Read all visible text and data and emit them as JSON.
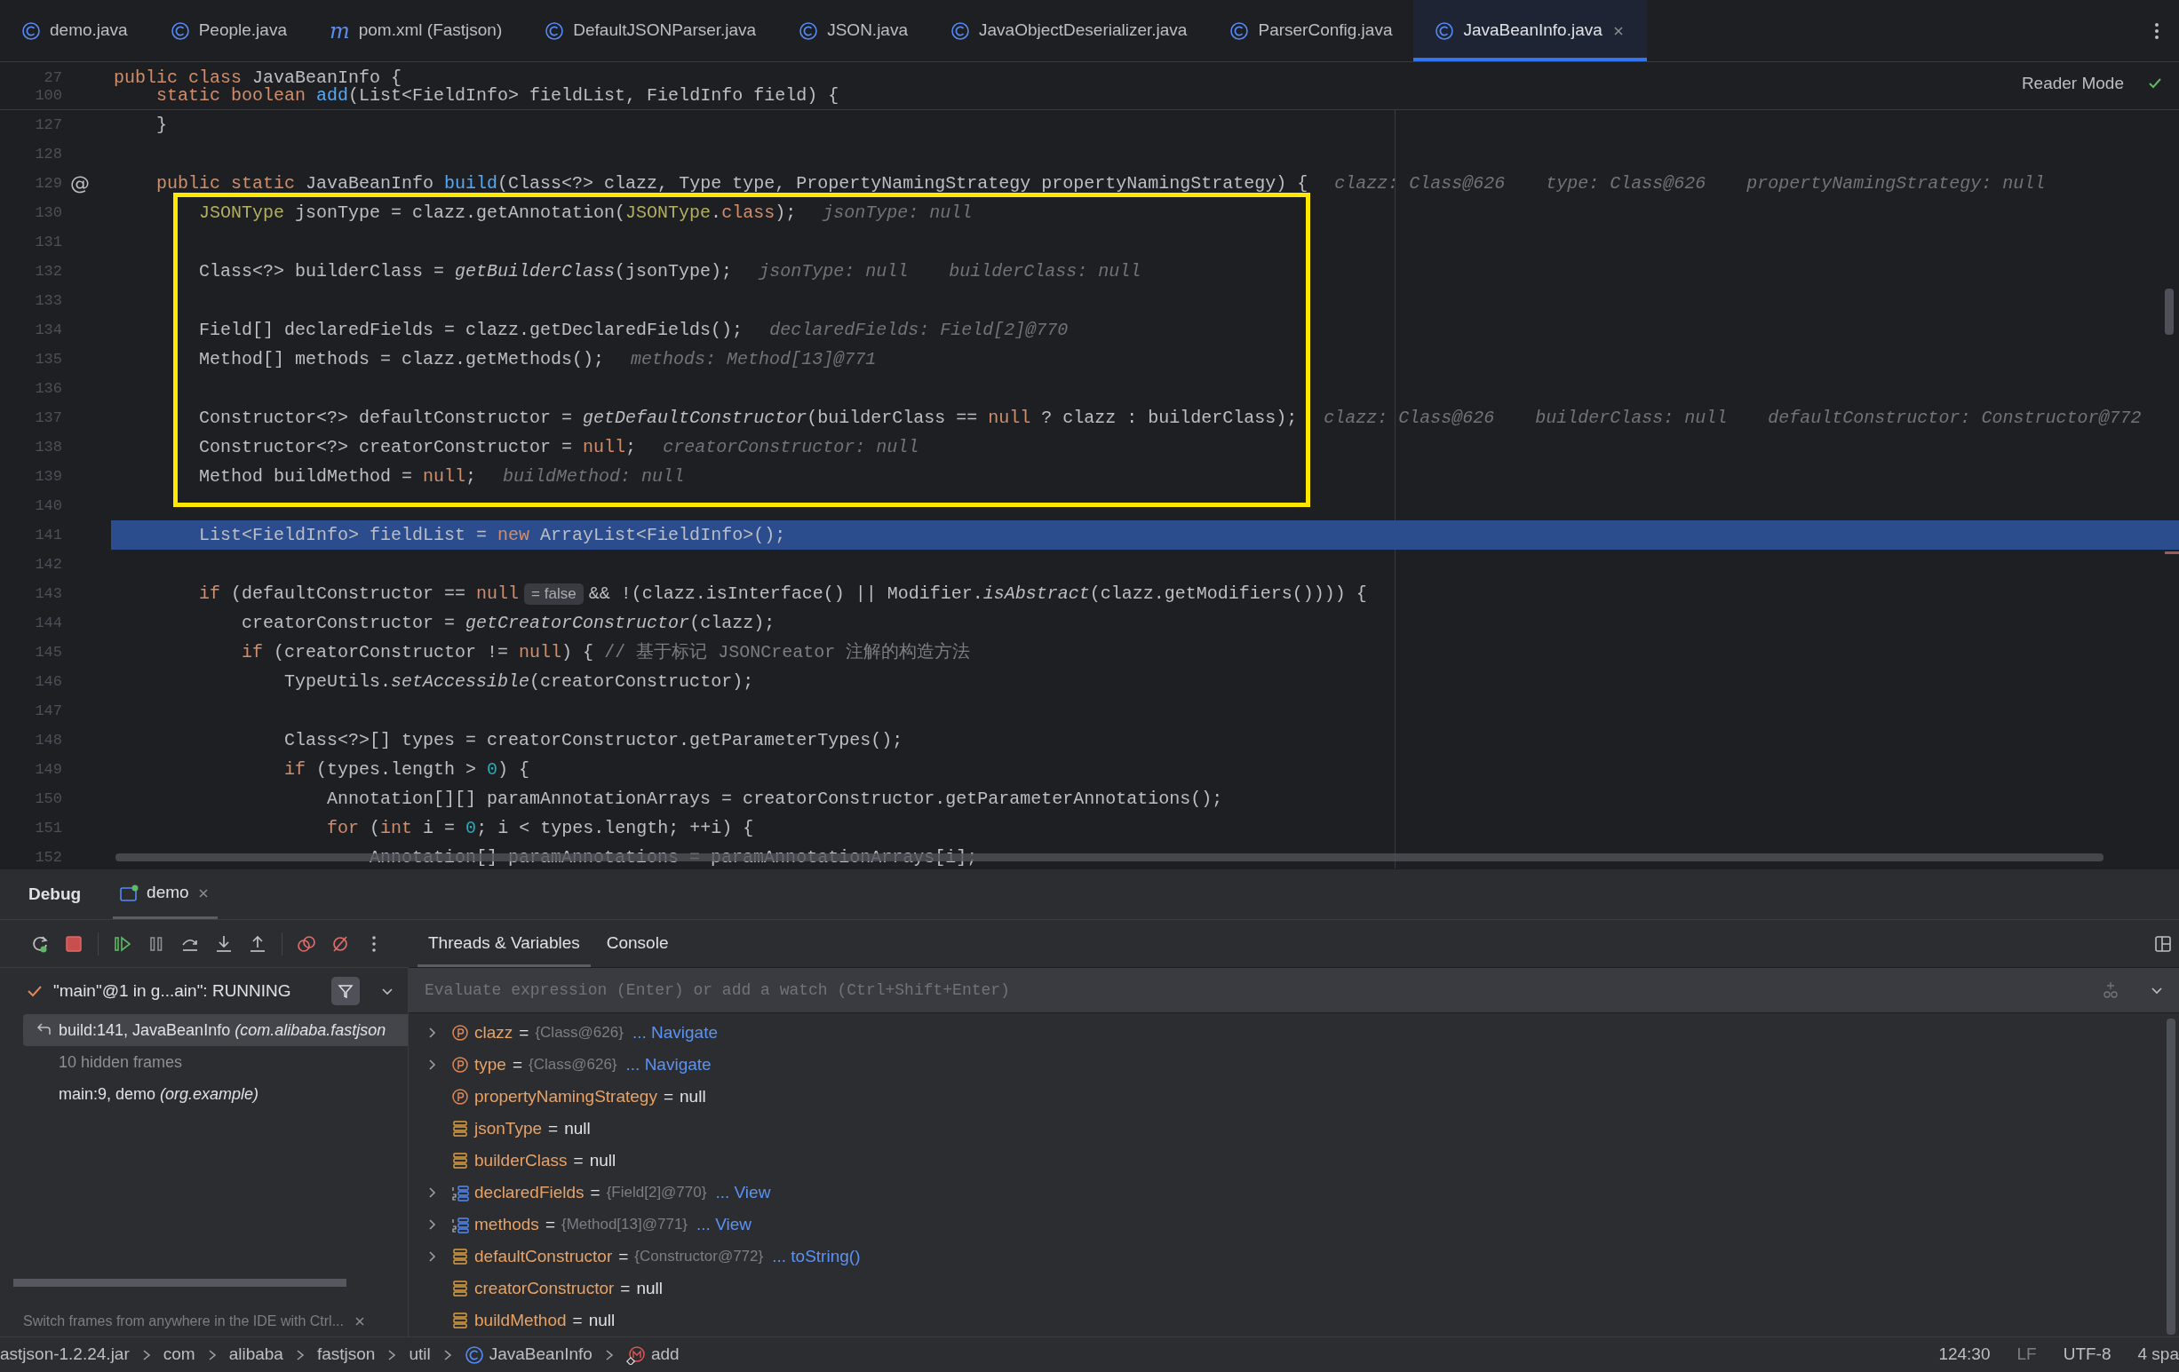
{
  "tabs": [
    {
      "label": "demo.java",
      "kind": "class",
      "selected": false
    },
    {
      "label": "People.java",
      "kind": "class",
      "selected": false
    },
    {
      "label": "pom.xml (Fastjson)",
      "kind": "maven",
      "icon_glyph": "m",
      "selected": false
    },
    {
      "label": "DefaultJSONParser.java",
      "kind": "class",
      "selected": false
    },
    {
      "label": "JSON.java",
      "kind": "class",
      "selected": false
    },
    {
      "label": "JavaObjectDeserializer.java",
      "kind": "class",
      "selected": false
    },
    {
      "label": "ParserConfig.java",
      "kind": "class",
      "selected": false
    },
    {
      "label": "JavaBeanInfo.java",
      "kind": "class",
      "selected": true
    }
  ],
  "editor": {
    "reader_mode": "Reader Mode",
    "sticky_lines": [
      {
        "number": "27",
        "tokens": [
          {
            "text": "public class",
            "kind": "kw"
          },
          {
            "text": " JavaBeanInfo {",
            "kind": "plain"
          }
        ]
      },
      {
        "number": "100",
        "tokens": [
          {
            "text": "    static boolean ",
            "kind": "kw"
          },
          {
            "text": "add",
            "kind": "decl"
          },
          {
            "text": "(List<FieldInfo> fieldList, FieldInfo field) {",
            "kind": "plain"
          }
        ]
      }
    ],
    "lines": [
      {
        "number": "127",
        "tokens": [
          {
            "text": "    }",
            "kind": "plain"
          }
        ],
        "boxed": false,
        "current": false
      },
      {
        "number": "128",
        "boxed": false,
        "current": false
      },
      {
        "number": "129",
        "gutter_mark": "@",
        "tokens": [
          {
            "text": "    public static",
            "kind": "kw"
          },
          {
            "text": " JavaBeanInfo ",
            "kind": "plain"
          },
          {
            "text": "build",
            "kind": "decl"
          },
          {
            "text": "(Class<?> clazz, Type type, PropertyNamingStrategy propertyNamingStrategy) {",
            "kind": "plain"
          }
        ],
        "hints": [
          "clazz: Class@626",
          "type: Class@626",
          "propertyNamingStrategy: null"
        ],
        "boxed": false,
        "current": false
      },
      {
        "number": "130",
        "tokens": [
          {
            "text": "        JSONType",
            "kind": "ann"
          },
          {
            "text": " jsonType = clazz.getAnnotation(",
            "kind": "plain"
          },
          {
            "text": "JSONType",
            "kind": "ann"
          },
          {
            "text": ".",
            "kind": "plain"
          },
          {
            "text": "class",
            "kind": "kw"
          },
          {
            "text": ");",
            "kind": "plain"
          }
        ],
        "hints": [
          "jsonType: null"
        ],
        "boxed": true,
        "current": false
      },
      {
        "number": "131",
        "boxed": true,
        "current": false
      },
      {
        "number": "132",
        "tokens": [
          {
            "text": "        Class<?> builderClass = ",
            "kind": "plain"
          },
          {
            "text": "getBuilderClass",
            "kind": "ital"
          },
          {
            "text": "(jsonType);",
            "kind": "plain"
          }
        ],
        "hints": [
          "jsonType: null",
          "builderClass: null"
        ],
        "boxed": true,
        "current": false
      },
      {
        "number": "133",
        "boxed": true,
        "current": false
      },
      {
        "number": "134",
        "tokens": [
          {
            "text": "        Field[] declaredFields = clazz.getDeclaredFields();",
            "kind": "plain"
          }
        ],
        "hints": [
          "declaredFields: Field[2]@770"
        ],
        "boxed": true,
        "current": false
      },
      {
        "number": "135",
        "tokens": [
          {
            "text": "        Method[] methods = clazz.getMethods();",
            "kind": "plain"
          }
        ],
        "hints": [
          "methods: Method[13]@771"
        ],
        "boxed": true,
        "current": false
      },
      {
        "number": "136",
        "boxed": true,
        "current": false
      },
      {
        "number": "137",
        "tokens": [
          {
            "text": "        Constructor<?> defaultConstructor = ",
            "kind": "plain"
          },
          {
            "text": "getDefaultConstructor",
            "kind": "ital"
          },
          {
            "text": "(builderClass == ",
            "kind": "plain"
          },
          {
            "text": "null",
            "kind": "kw"
          },
          {
            "text": " ? clazz : builderClass);",
            "kind": "plain"
          }
        ],
        "hints": [
          "clazz: Class@626",
          "builderClass: null",
          "defaultConstructor: Constructor@772"
        ],
        "boxed": true,
        "current": false
      },
      {
        "number": "138",
        "tokens": [
          {
            "text": "        Constructor<?> creatorConstructor = ",
            "kind": "plain"
          },
          {
            "text": "null",
            "kind": "kw"
          },
          {
            "text": ";",
            "kind": "plain"
          }
        ],
        "hints": [
          "creatorConstructor: null"
        ],
        "boxed": true,
        "current": false
      },
      {
        "number": "139",
        "tokens": [
          {
            "text": "        Method buildMethod = ",
            "kind": "plain"
          },
          {
            "text": "null",
            "kind": "kw"
          },
          {
            "text": ";",
            "kind": "plain"
          }
        ],
        "hints": [
          "buildMethod: null"
        ],
        "boxed": true,
        "current": false
      },
      {
        "number": "140",
        "boxed": false,
        "current": false
      },
      {
        "number": "141",
        "tokens": [
          {
            "text": "        List<FieldInfo> fieldList = ",
            "kind": "plain"
          },
          {
            "text": "new",
            "kind": "kw"
          },
          {
            "text": " ArrayList<FieldInfo>();",
            "kind": "plain"
          }
        ],
        "boxed": false,
        "current": true
      },
      {
        "number": "142",
        "boxed": false,
        "current": false
      },
      {
        "number": "143",
        "tokens": [
          {
            "text": "        if",
            "kind": "kw"
          },
          {
            "text": " (defaultConstructor == ",
            "kind": "plain"
          },
          {
            "text": "null",
            "kind": "kw"
          },
          {
            "text": "= false",
            "kind": "badge"
          },
          {
            "text": "&& !(clazz.isInterface() || Modifier.",
            "kind": "plain"
          },
          {
            "text": "isAbstract",
            "kind": "ital"
          },
          {
            "text": "(clazz.getModifiers()))) {",
            "kind": "plain"
          }
        ],
        "boxed": false,
        "current": false
      },
      {
        "number": "144",
        "tokens": [
          {
            "text": "            creatorConstructor = ",
            "kind": "plain"
          },
          {
            "text": "getCreatorConstructor",
            "kind": "ital"
          },
          {
            "text": "(clazz);",
            "kind": "plain"
          }
        ],
        "boxed": false,
        "current": false
      },
      {
        "number": "145",
        "tokens": [
          {
            "text": "            if",
            "kind": "kw"
          },
          {
            "text": " (creatorConstructor != ",
            "kind": "plain"
          },
          {
            "text": "null",
            "kind": "kw"
          },
          {
            "text": ") { ",
            "kind": "plain"
          },
          {
            "text": "// 基于标记 JSONCreator 注解的构造方法",
            "kind": "cmt"
          }
        ],
        "boxed": false,
        "current": false
      },
      {
        "number": "146",
        "tokens": [
          {
            "text": "                TypeUtils.",
            "kind": "plain"
          },
          {
            "text": "setAccessible",
            "kind": "ital"
          },
          {
            "text": "(creatorConstructor);",
            "kind": "plain"
          }
        ],
        "boxed": false,
        "current": false
      },
      {
        "number": "147",
        "boxed": false,
        "current": false
      },
      {
        "number": "148",
        "tokens": [
          {
            "text": "                Class<?>[] types = creatorConstructor.getParameterTypes();",
            "kind": "plain"
          }
        ],
        "boxed": false,
        "current": false
      },
      {
        "number": "149",
        "tokens": [
          {
            "text": "                if",
            "kind": "kw"
          },
          {
            "text": " (types.length > ",
            "kind": "plain"
          },
          {
            "text": "0",
            "kind": "num"
          },
          {
            "text": ") {",
            "kind": "plain"
          }
        ],
        "boxed": false,
        "current": false
      },
      {
        "number": "150",
        "tokens": [
          {
            "text": "                    Annotation[][] paramAnnotationArrays = creatorConstructor.getParameterAnnotations();",
            "kind": "plain"
          }
        ],
        "boxed": false,
        "current": false
      },
      {
        "number": "151",
        "tokens": [
          {
            "text": "                    for",
            "kind": "kw"
          },
          {
            "text": " (",
            "kind": "plain"
          },
          {
            "text": "int",
            "kind": "kw"
          },
          {
            "text": " i = ",
            "kind": "plain"
          },
          {
            "text": "0",
            "kind": "num"
          },
          {
            "text": "; i < types.length; ++i) {",
            "kind": "plain"
          }
        ],
        "boxed": false,
        "current": false
      },
      {
        "number": "152",
        "tokens": [
          {
            "text": "                        Annotation[] paramAnnotations = paramAnnotationArrays[i];",
            "kind": "plain"
          }
        ],
        "boxed": false,
        "current": false
      }
    ]
  },
  "debug": {
    "title": "Debug",
    "sessions": [
      {
        "label": "demo",
        "selected": true
      }
    ],
    "view_tabs": [
      {
        "label": "Threads & Variables",
        "selected": true
      },
      {
        "label": "Console",
        "selected": false
      }
    ],
    "thread": "\"main\"@1 in g...ain\": RUNNING",
    "frames": [
      {
        "kind": "frame",
        "text": "build:141, JavaBeanInfo *(com.alibaba.fastjson*",
        "selected": true
      },
      {
        "kind": "hidden",
        "text": "10 hidden frames",
        "selected": false
      },
      {
        "kind": "frame",
        "text": "main:9, demo *(org.example)*",
        "selected": false
      }
    ],
    "tip": "Switch frames from anywhere in the IDE with Ctrl...",
    "evaluate_placeholder": "Evaluate expression (Enter) or add a watch (Ctrl+Shift+Enter)",
    "variables": [
      {
        "name": "clazz",
        "kind": "param",
        "expandable": true,
        "assign": "=",
        "ref": "{Class@626}",
        "link": "... Navigate"
      },
      {
        "name": "type",
        "kind": "param",
        "expandable": true,
        "assign": "=",
        "ref": "{Class@626}",
        "link": "... Navigate"
      },
      {
        "name": "propertyNamingStrategy",
        "kind": "param",
        "expandable": false,
        "assign": "=",
        "value": "null"
      },
      {
        "name": "jsonType",
        "kind": "local",
        "expandable": false,
        "assign": "=",
        "value": "null"
      },
      {
        "name": "builderClass",
        "kind": "local",
        "expandable": false,
        "assign": "=",
        "value": "null"
      },
      {
        "name": "declaredFields",
        "kind": "array",
        "expandable": true,
        "assign": "=",
        "ref": "{Field[2]@770}",
        "link": "... View"
      },
      {
        "name": "methods",
        "kind": "array",
        "expandable": true,
        "assign": "=",
        "ref": "{Method[13]@771}",
        "link": "... View"
      },
      {
        "name": "defaultConstructor",
        "kind": "local",
        "expandable": true,
        "assign": "=",
        "ref": "{Constructor@772}",
        "link": "... toString()"
      },
      {
        "name": "creatorConstructor",
        "kind": "local",
        "expandable": false,
        "assign": "=",
        "value": "null"
      },
      {
        "name": "buildMethod",
        "kind": "local",
        "expandable": false,
        "assign": "=",
        "value": "null"
      }
    ]
  },
  "status_bar": {
    "breadcrumbs": [
      {
        "text": "astjson-1.2.24.jar",
        "kind": "folder"
      },
      {
        "text": "com",
        "kind": "folder"
      },
      {
        "text": "alibaba",
        "kind": "folder"
      },
      {
        "text": "fastjson",
        "kind": "folder"
      },
      {
        "text": "util",
        "kind": "folder"
      },
      {
        "text": "JavaBeanInfo",
        "kind": "class"
      },
      {
        "text": "add",
        "kind": "method"
      }
    ],
    "items": [
      "124:30",
      "LF",
      "UTF-8",
      "4 spa"
    ]
  }
}
